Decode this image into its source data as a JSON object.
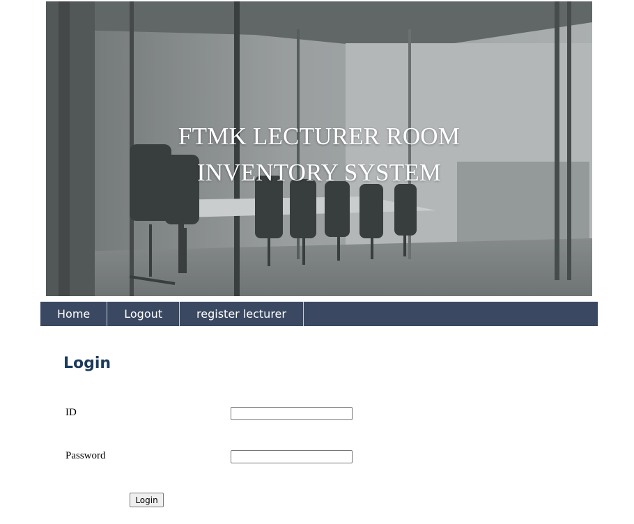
{
  "banner": {
    "title_line1": "FTMK LECTURER ROOM",
    "title_line2": "INVENTORY SYSTEM"
  },
  "nav": {
    "items": [
      {
        "label": "Home"
      },
      {
        "label": "Logout"
      },
      {
        "label": "register lecturer"
      }
    ]
  },
  "login": {
    "heading": "Login",
    "id_label": "ID",
    "id_value": "",
    "password_label": "Password",
    "password_value": "",
    "button_label": "Login"
  },
  "colors": {
    "nav_background": "#3a4961",
    "heading": "#1b3a5c"
  }
}
